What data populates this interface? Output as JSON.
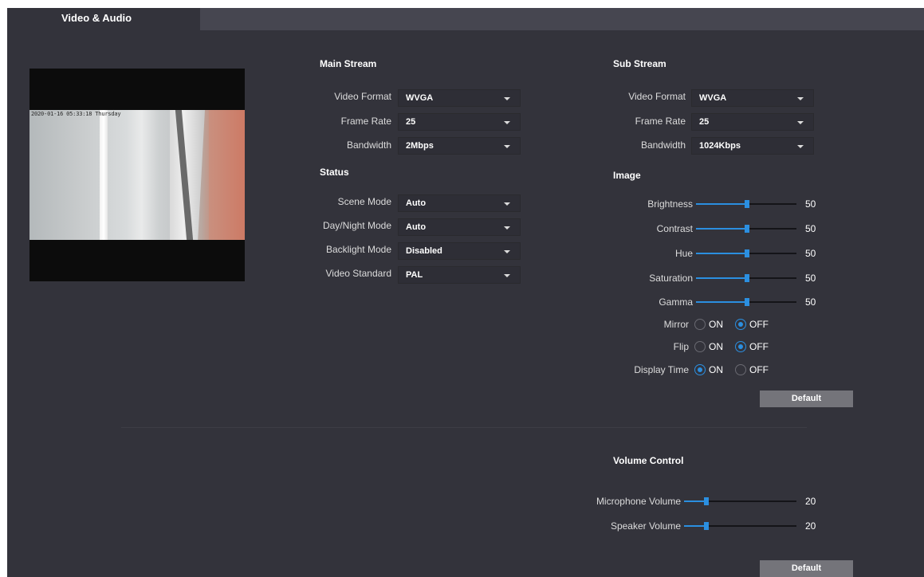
{
  "tab": {
    "label": "Video & Audio"
  },
  "preview": {
    "osd": "2020-01-16 05:33:18 Thursday"
  },
  "main_stream": {
    "title": "Main Stream",
    "fields": [
      {
        "label": "Video Format",
        "value": "WVGA"
      },
      {
        "label": "Frame Rate",
        "value": "25"
      },
      {
        "label": "Bandwidth",
        "value": "2Mbps"
      }
    ]
  },
  "sub_stream": {
    "title": "Sub Stream",
    "fields": [
      {
        "label": "Video Format",
        "value": "WVGA"
      },
      {
        "label": "Frame Rate",
        "value": "25"
      },
      {
        "label": "Bandwidth",
        "value": "1024Kbps"
      }
    ]
  },
  "status": {
    "title": "Status",
    "fields": [
      {
        "label": "Scene Mode",
        "value": "Auto"
      },
      {
        "label": "Day/Night Mode",
        "value": "Auto"
      },
      {
        "label": "Backlight Mode",
        "value": "Disabled"
      },
      {
        "label": "Video Standard",
        "value": "PAL"
      }
    ]
  },
  "image": {
    "title": "Image",
    "sliders": [
      {
        "label": "Brightness",
        "value": "50"
      },
      {
        "label": "Contrast",
        "value": "50"
      },
      {
        "label": "Hue",
        "value": "50"
      },
      {
        "label": "Saturation",
        "value": "50"
      },
      {
        "label": "Gamma",
        "value": "50"
      }
    ],
    "toggles": [
      {
        "label": "Mirror",
        "on_label": "ON",
        "off_label": "OFF",
        "selected": "OFF"
      },
      {
        "label": "Flip",
        "on_label": "ON",
        "off_label": "OFF",
        "selected": "OFF"
      },
      {
        "label": "Display Time",
        "on_label": "ON",
        "off_label": "OFF",
        "selected": "ON"
      }
    ],
    "default_label": "Default"
  },
  "volume": {
    "title": "Volume Control",
    "sliders": [
      {
        "label": "Microphone Volume",
        "value": "20"
      },
      {
        "label": "Speaker Volume",
        "value": "20"
      }
    ],
    "default_label": "Default"
  },
  "colors": {
    "accent": "#2b8fe0",
    "panel": "#33333b",
    "tabbar": "#464650",
    "button": "#74747a"
  }
}
